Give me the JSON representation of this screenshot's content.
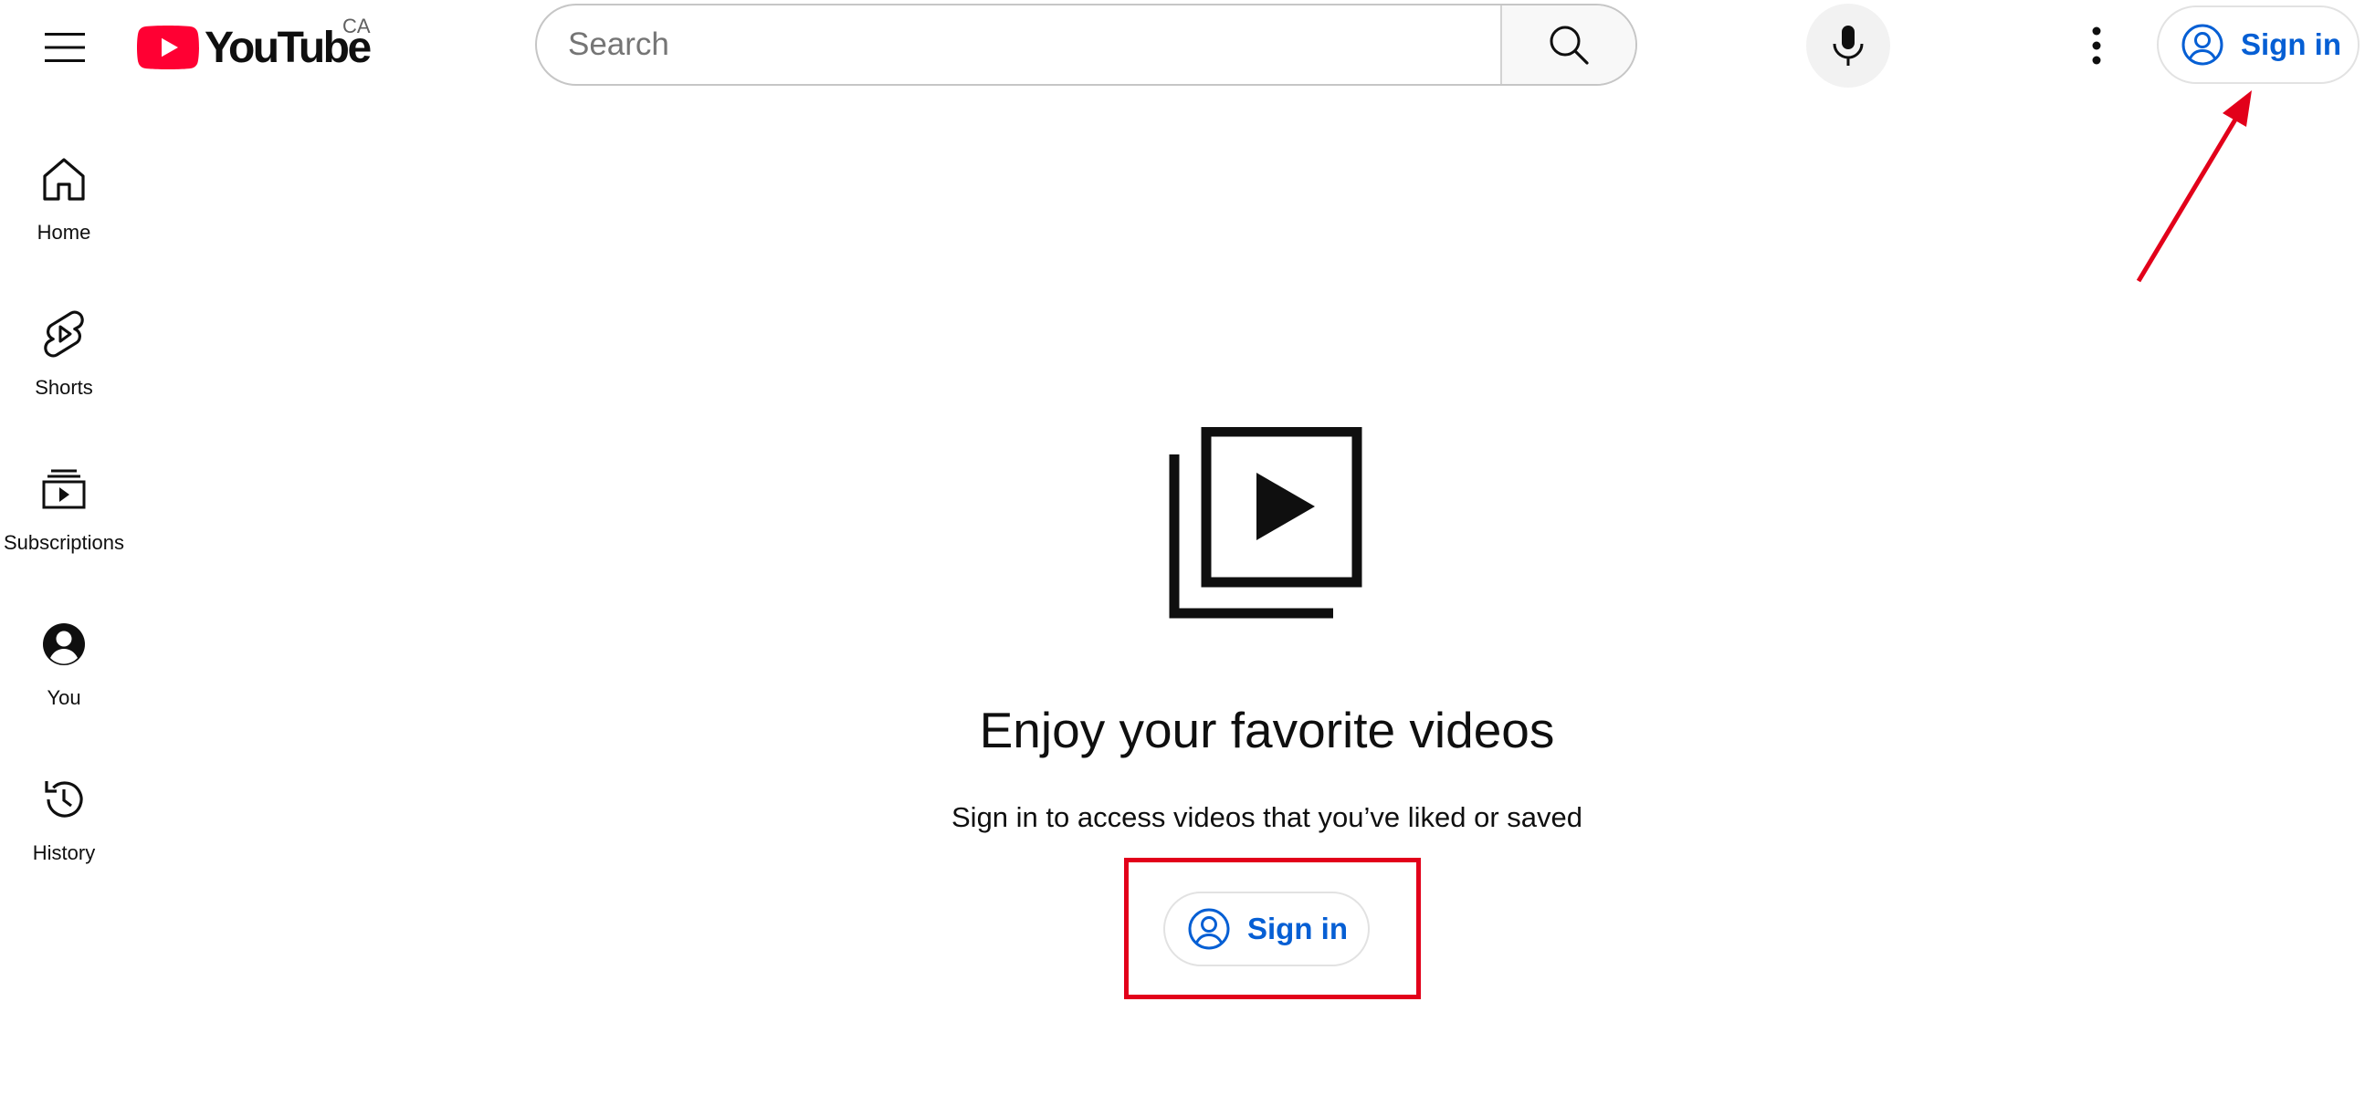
{
  "header": {
    "logo_text": "YouTube",
    "country_code": "CA",
    "search_placeholder": "Search",
    "signin_label": "Sign in"
  },
  "sidebar": {
    "items": [
      {
        "label": "Home",
        "icon": "home-icon"
      },
      {
        "label": "Shorts",
        "icon": "shorts-icon"
      },
      {
        "label": "Subscriptions",
        "icon": "subscriptions-icon"
      },
      {
        "label": "You",
        "icon": "account-circle-icon"
      },
      {
        "label": "History",
        "icon": "history-icon"
      }
    ]
  },
  "main": {
    "title": "Enjoy your favorite videos",
    "subtitle": "Sign in to access videos that you’ve liked or saved",
    "signin_label": "Sign in"
  },
  "colors": {
    "brand_red": "#ff0033",
    "link_blue": "#065fd4",
    "annotation_red": "#e2001a"
  }
}
